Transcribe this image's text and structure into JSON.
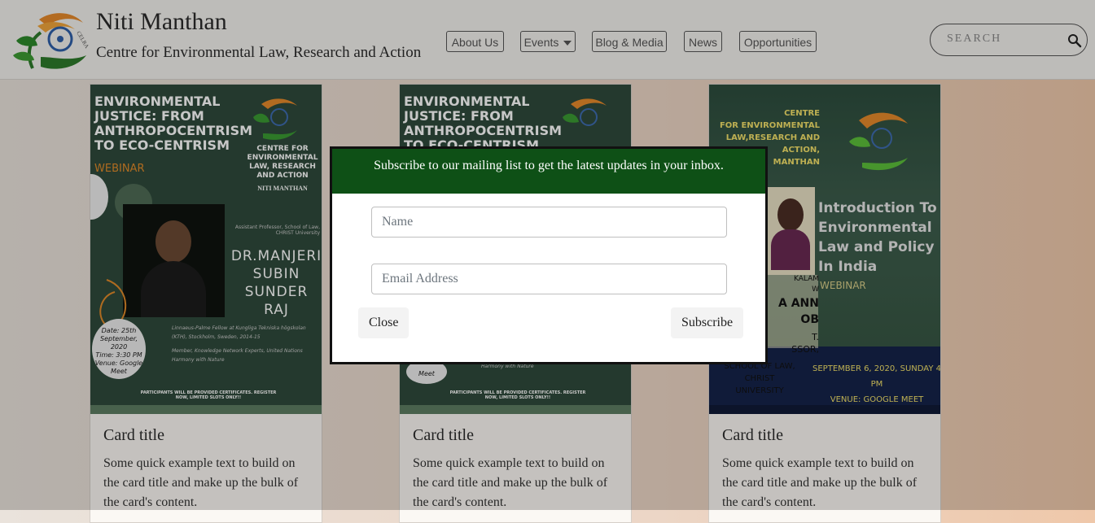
{
  "brand": {
    "title": "Niti Manthan",
    "subtitle": "Centre for Environmental Law, Research and Action",
    "logo_text": "CELRA"
  },
  "nav": {
    "items": [
      {
        "label": "About Us"
      },
      {
        "label": "Events"
      },
      {
        "label": "Blog & Media"
      },
      {
        "label": "News"
      },
      {
        "label": "Opportunities"
      }
    ]
  },
  "search": {
    "placeholder": "SEARCH"
  },
  "cards": [
    {
      "title": "Card title",
      "text": "Some quick example text to build on the card title and make up the bulk of the card's content.",
      "poster": {
        "heading": [
          "ENVIRONMENTAL",
          "JUSTICE: FROM",
          "ANTHROPOCENTRISM",
          "TO ECO-CENTRISM"
        ],
        "tag": "WEBINAR",
        "org": [
          "CENTRE FOR",
          "ENVIRONMENTAL",
          "LAW, RESEARCH",
          "AND ACTION"
        ],
        "org_sub": "NITI MANTHAN",
        "role": "Assistant Professor, School of Law, CHRIST University",
        "speaker": [
          "DR.MANJERI",
          "SUBIN",
          "SUNDER",
          "RAJ"
        ],
        "date": [
          "Date: 25th",
          "September, 2020",
          "Time: 3:30 PM",
          "Venue: Google",
          "Meet"
        ],
        "bio1": "Linnaeus-Palme Fellow at Kungliga Tekniska högskolan (KTH), Stockholm, Sweden, 2014-15",
        "bio2": "Member, Knowledge Network Experts, United Nations Harmony with Nature",
        "footer": "PARTICIPANTS WILL BE PROVIDED CERTIFICATES. REGISTER NOW, LIMITED SLOTS ONLY!!"
      }
    },
    {
      "title": "Card title",
      "text": "Some quick example text to build on the card title and make up the bulk of the card's content.",
      "poster": {
        "heading": [
          "ENVIRONMENTAL",
          "JUSTICE: FROM",
          "ANTHROPOCENTRISM",
          "TO ECO-CENTRISM"
        ],
        "date_tail": "Meet",
        "bio_tail": "Harmony with Nature",
        "footer": "PARTICIPANTS WILL BE PROVIDED CERTIFICATES. REGISTER NOW, LIMITED SLOTS ONLY!!"
      }
    },
    {
      "title": "Card title",
      "text": "Some quick example text to build on the card title and make up the bulk of the card's content.",
      "poster": {
        "org": [
          "CENTRE",
          "FOR ENVIRONMENTAL",
          "LAW,RESEARCH AND",
          "ACTION,",
          "MANTHAN"
        ],
        "heading": [
          "Introduction To",
          "Environmental",
          "Law and Policy",
          "In India"
        ],
        "tag": "WEBINAR",
        "speaker_partial": [
          "KALAM",
          "W",
          "A ANN",
          "OB",
          "T.",
          "SSOR,",
          "SCHOOL OF LAW,",
          "CHRIST",
          "UNIVERSITY"
        ],
        "date": [
          "SEPTEMBER 6, 2020, SUNDAY 4 PM",
          "VENUE: GOOGLE MEET"
        ]
      }
    }
  ],
  "modal": {
    "header": "Subscribe to our mailing list to get the latest updates in your inbox.",
    "name_placeholder": "Name",
    "email_placeholder": "Email Address",
    "close_label": "Close",
    "subscribe_label": "Subscribe"
  },
  "colors": {
    "modal_header": "#0e5016",
    "poster_green": "#2f4a3b",
    "accent_orange": "#e08a2a"
  }
}
